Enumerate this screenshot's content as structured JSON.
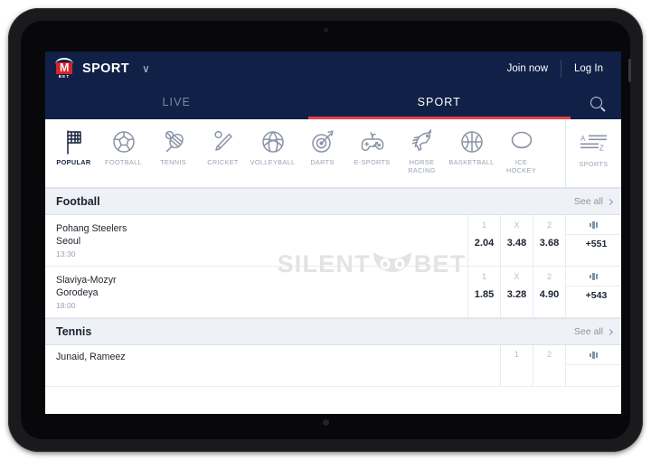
{
  "brand": {
    "logo_letter": "M",
    "logo_sub": "BET",
    "title": "SPORT",
    "caret": "∨"
  },
  "topbar": {
    "join_label": "Join now",
    "login_label": "Log In"
  },
  "tabs": {
    "live": "LIVE",
    "sport": "SPORT",
    "active": "SPORT",
    "search_icon": "search-icon"
  },
  "sports": [
    {
      "label": "POPULAR",
      "icon": "flag-icon",
      "active": true
    },
    {
      "label": "FOOTBALL",
      "icon": "football-icon",
      "active": false
    },
    {
      "label": "TENNIS",
      "icon": "tennis-icon",
      "active": false
    },
    {
      "label": "CRICKET",
      "icon": "cricket-icon",
      "active": false
    },
    {
      "label": "VOLLEYBALL",
      "icon": "volleyball-icon",
      "active": false
    },
    {
      "label": "DARTS",
      "icon": "darts-icon",
      "active": false
    },
    {
      "label": "E-SPORTS",
      "icon": "gamepad-icon",
      "active": false
    },
    {
      "label": "HORSE\nRACING",
      "icon": "horse-icon",
      "active": false
    },
    {
      "label": "BASKETBALL",
      "icon": "basketball-icon",
      "active": false
    },
    {
      "label": "ICE\nHOCKEY",
      "icon": "hockey-puck-icon",
      "active": false
    }
  ],
  "az_button": {
    "label": "SPORTS",
    "icon": "a-z-list-icon"
  },
  "sections": [
    {
      "title": "Football",
      "see_all": "See all",
      "events": [
        {
          "home": "Pohang Steelers",
          "away": "Seoul",
          "time": "13:30",
          "odds": [
            {
              "key": "1",
              "value": "2.04"
            },
            {
              "key": "X",
              "value": "3.48"
            },
            {
              "key": "2",
              "value": "3.68"
            }
          ],
          "more": "+551",
          "more_icon": "bar-chart-icon"
        },
        {
          "home": "Slaviya-Mozyr",
          "away": "Gorodeya",
          "time": "18:00",
          "odds": [
            {
              "key": "1",
              "value": "1.85"
            },
            {
              "key": "X",
              "value": "3.28"
            },
            {
              "key": "2",
              "value": "4.90"
            }
          ],
          "more": "+543",
          "more_icon": "bar-chart-icon"
        }
      ]
    },
    {
      "title": "Tennis",
      "see_all": "See all",
      "events": [
        {
          "home": "Junaid, Rameez",
          "away": "",
          "time": "",
          "odds": [
            {
              "key": "1",
              "value": ""
            },
            {
              "key": "2",
              "value": ""
            }
          ],
          "more": "",
          "more_icon": "bar-chart-icon"
        }
      ]
    }
  ],
  "watermark": {
    "left_text": "SILENT",
    "right_text": "BET",
    "logo": "owl-icon"
  },
  "colors": {
    "header_navy": "#102046",
    "accent_red": "#e8414e",
    "logo_red": "#d8232a",
    "section_gray": "#eef1f5",
    "muted_text": "#9aa3b4"
  }
}
